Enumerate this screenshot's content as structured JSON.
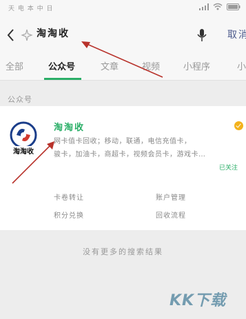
{
  "status_bar": {
    "carrier": "天 电 本 中 日",
    "battery_percent": ""
  },
  "search": {
    "query": "淘淘收",
    "cancel_label": "取消"
  },
  "tabs": [
    {
      "label": "全部"
    },
    {
      "label": "公众号"
    },
    {
      "label": "文章"
    },
    {
      "label": "视频"
    },
    {
      "label": "小程序"
    },
    {
      "label": "小"
    }
  ],
  "section_label": "公众号",
  "account": {
    "name": "淘淘收",
    "logo_text": "淘淘收",
    "description_line1": "网卡值卡回收；移动，联通，电信充值卡，",
    "description_line2": "骏卡，加油卡，商超卡，视频会员卡，游戏卡…",
    "follow_status": "已关注",
    "menu": [
      "卡卷转让",
      "账户管理",
      "积分兑换",
      "回收流程"
    ]
  },
  "footer": {
    "no_more": "没有更多的搜索结果"
  },
  "watermark": {
    "text": "KK下载"
  },
  "colors": {
    "accent": "#2aae67",
    "verify": "#f3b21c",
    "annotation": "#b8322b"
  }
}
